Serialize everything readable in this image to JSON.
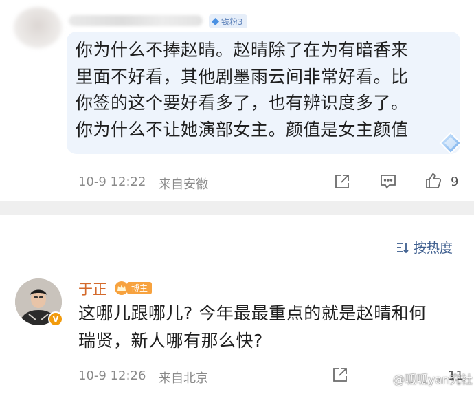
{
  "comment1": {
    "fan_badge": "铁粉3",
    "lines": [
      "你为什么不捧赵晴。赵晴除了在为有暗香来",
      "里面不好看，其他剧墨雨云间非常好看。比",
      "你签的这个要好看多了，也有辨识度多了。",
      "你为什么不让她演部女主。颜值是女主颜值"
    ],
    "time": "10-9 12:22",
    "location": "来自安徽",
    "likes": "9"
  },
  "sort_label": "按热度",
  "comment2": {
    "author": "于正",
    "badge": "博主",
    "verified_mark": "V",
    "lines": [
      "这哪儿跟哪儿? 今年最最重点的就是赵晴和何",
      "瑞贤，新人哪有那么快?"
    ],
    "time": "10-9 12:26",
    "location": "来自北京",
    "likes": "11"
  },
  "watermark": "@呱呱yan究社",
  "colors": {
    "author": "#d46a2c",
    "bubble": "#eef4fc",
    "link": "#3f5f8f"
  }
}
